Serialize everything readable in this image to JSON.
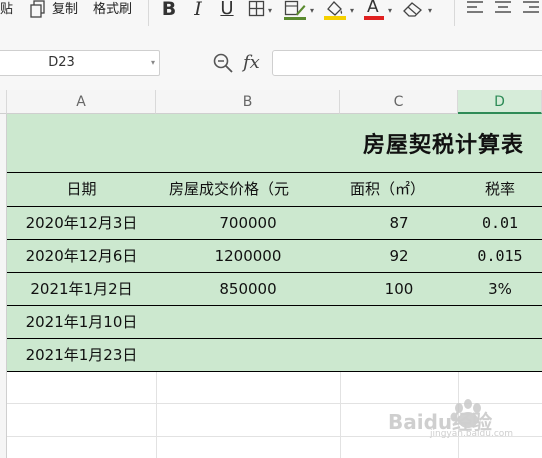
{
  "toolbar": {
    "paste_label": "贴",
    "copy_label": "复制",
    "format_painter_label": "格式刷",
    "bold_icon": "B",
    "italic_icon": "I",
    "underline_icon": "U",
    "font_color_letter": "A",
    "font_color": "#e02020",
    "fill_color": "#f5d000"
  },
  "formula_bar": {
    "name_box": "D23",
    "fx_label": "fx",
    "formula": ""
  },
  "columns": [
    {
      "label": "A",
      "selected": false
    },
    {
      "label": "B",
      "selected": false
    },
    {
      "label": "C",
      "selected": false
    },
    {
      "label": "D",
      "selected": true
    }
  ],
  "sheet": {
    "title": "房屋契税计算表",
    "headers": [
      "日期",
      "房屋成交价格（元",
      "面积（㎡）",
      "税率"
    ],
    "rows": [
      [
        "2020年12月3日",
        "700000",
        "87",
        "0.01"
      ],
      [
        "2020年12月6日",
        "1200000",
        "92",
        "0.015"
      ],
      [
        "2021年1月2日",
        "850000",
        "100",
        "3%"
      ],
      [
        "2021年1月10日",
        "",
        "",
        ""
      ],
      [
        "2021年1月23日",
        "",
        "",
        ""
      ]
    ],
    "fill_color": "#cce8cf"
  },
  "watermark": {
    "text": "Baidu经验",
    "subtext": "jingyan.baidu.com"
  }
}
